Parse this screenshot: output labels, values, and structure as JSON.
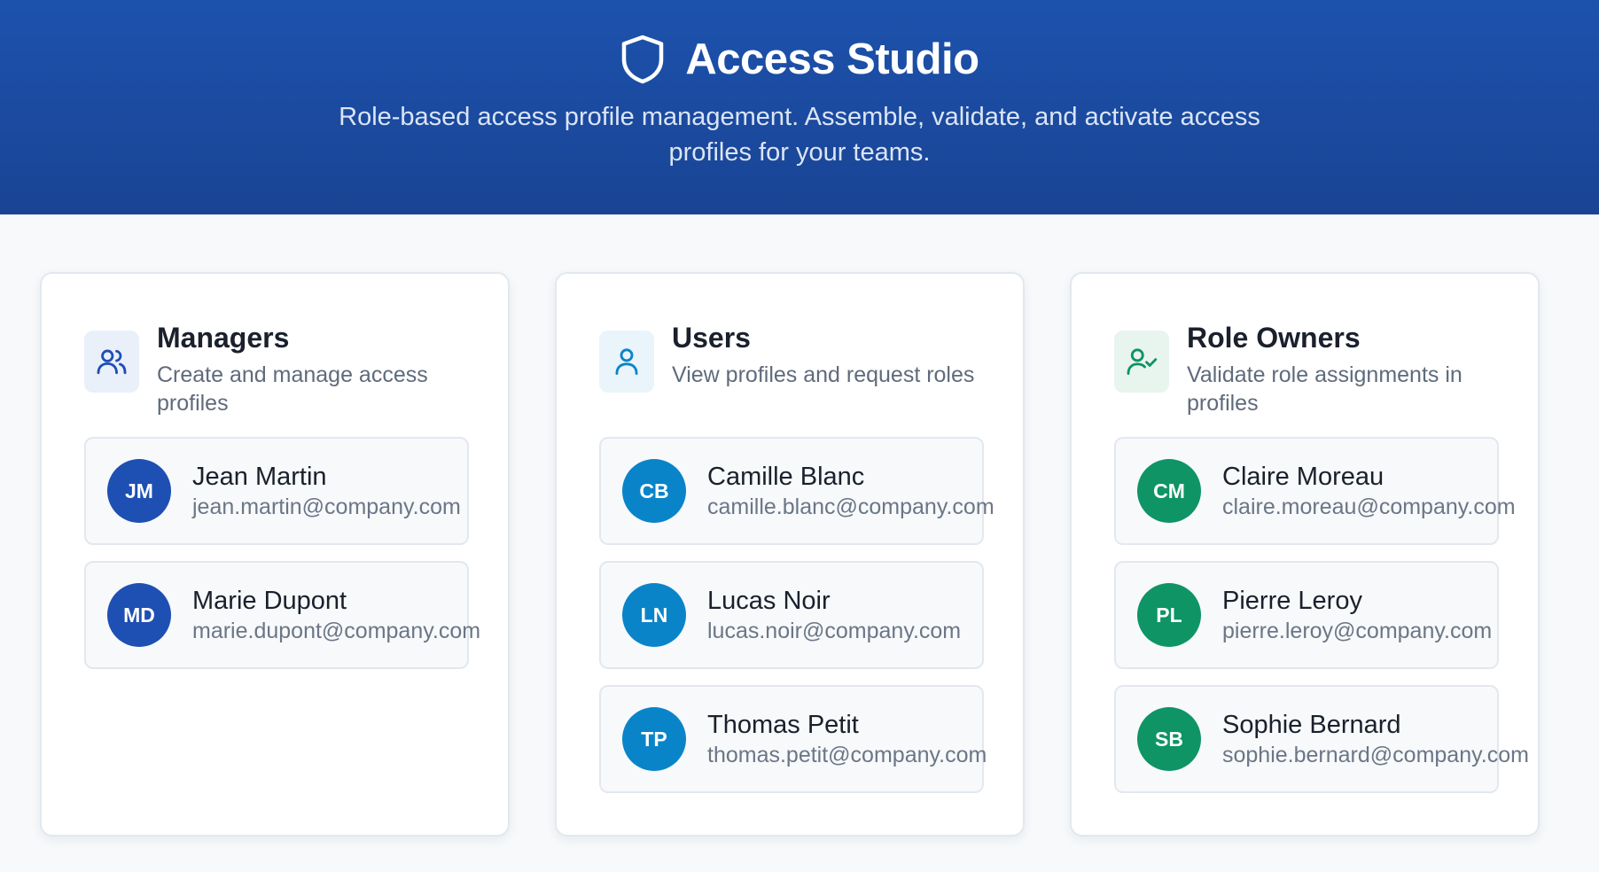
{
  "header": {
    "title": "Access Studio",
    "subtitle": "Role-based access profile management. Assemble, validate, and activate access profiles for your teams.",
    "icon": "shield-icon"
  },
  "panels": [
    {
      "title": "Managers",
      "description": "Create and manage access profiles",
      "icon": "users-icon",
      "accent": "#1e4fb3",
      "icon_bg": "#eaf0fa",
      "members": [
        {
          "initials": "JM",
          "name": "Jean Martin",
          "email": "jean.martin@company.com"
        },
        {
          "initials": "MD",
          "name": "Marie Dupont",
          "email": "marie.dupont@company.com"
        }
      ]
    },
    {
      "title": "Users",
      "description": "View profiles and request roles",
      "icon": "user-icon",
      "accent": "#0a84c9",
      "icon_bg": "#e9f4fb",
      "members": [
        {
          "initials": "CB",
          "name": "Camille Blanc",
          "email": "camille.blanc@company.com"
        },
        {
          "initials": "LN",
          "name": "Lucas Noir",
          "email": "lucas.noir@company.com"
        },
        {
          "initials": "TP",
          "name": "Thomas Petit",
          "email": "thomas.petit@company.com"
        }
      ]
    },
    {
      "title": "Role Owners",
      "description": "Validate role assignments in profiles",
      "icon": "user-check-icon",
      "accent": "#0f9465",
      "icon_bg": "#e8f5ef",
      "members": [
        {
          "initials": "CM",
          "name": "Claire Moreau",
          "email": "claire.moreau@company.com"
        },
        {
          "initials": "PL",
          "name": "Pierre Leroy",
          "email": "pierre.leroy@company.com"
        },
        {
          "initials": "SB",
          "name": "Sophie Bernard",
          "email": "sophie.bernard@company.com"
        }
      ]
    }
  ]
}
